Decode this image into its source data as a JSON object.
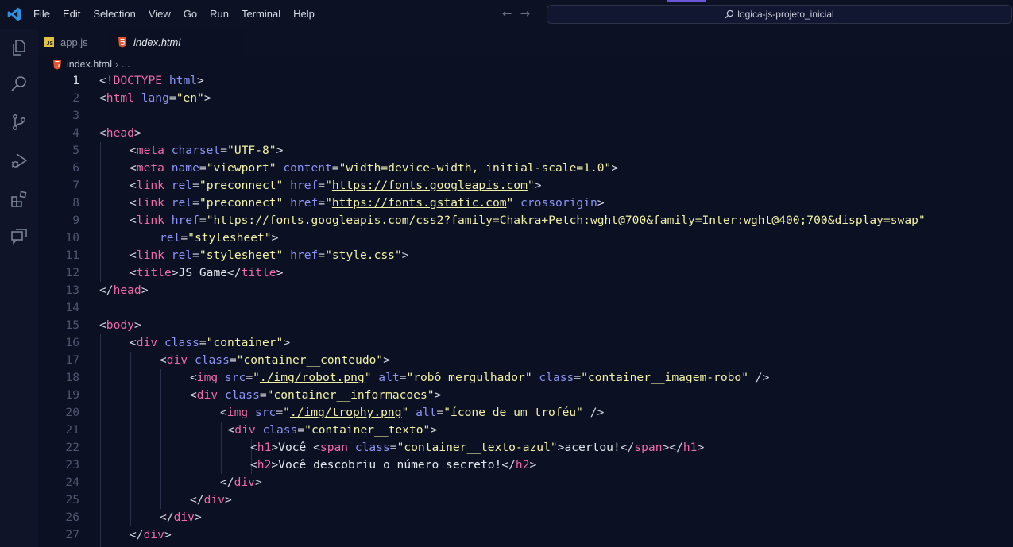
{
  "menu": [
    "File",
    "Edit",
    "Selection",
    "View",
    "Go",
    "Run",
    "Terminal",
    "Help"
  ],
  "search": {
    "text": "logica-js-projeto_inicial"
  },
  "tabs": [
    {
      "label": "app.js",
      "icon": "js-file-icon"
    },
    {
      "label": "index.html",
      "icon": "html-file-icon"
    }
  ],
  "breadcrumb": {
    "file": "index.html",
    "rest": "..."
  },
  "activity_icons": [
    "explorer-icon",
    "search-icon",
    "source-control-icon",
    "run-debug-icon",
    "extensions-icon",
    "chat-icon"
  ],
  "colors": {
    "tag": "#ef6aa9",
    "attr": "#8b94f2",
    "string": "#f1f1a6",
    "annotation": "#e0202a"
  },
  "current_line": 1,
  "code_lines": [
    {
      "n": "1",
      "indent": 0,
      "tokens": [
        [
          "p",
          "<"
        ],
        [
          "t",
          "!DOCTYPE"
        ],
        [
          "a",
          " html"
        ],
        [
          "p",
          ">"
        ]
      ]
    },
    {
      "n": "2",
      "indent": 0,
      "tokens": [
        [
          "p",
          "<"
        ],
        [
          "t",
          "html"
        ],
        [
          "a",
          " lang"
        ],
        [
          "p",
          "="
        ],
        [
          "s",
          "\"en\""
        ],
        [
          "p",
          ">"
        ]
      ]
    },
    {
      "n": "3",
      "indent": 0,
      "tokens": []
    },
    {
      "n": "4",
      "indent": 0,
      "tokens": [
        [
          "p",
          "<"
        ],
        [
          "t",
          "head"
        ],
        [
          "p",
          ">"
        ]
      ]
    },
    {
      "n": "5",
      "indent": 1,
      "tokens": [
        [
          "p",
          "<"
        ],
        [
          "t",
          "meta"
        ],
        [
          "a",
          " charset"
        ],
        [
          "p",
          "="
        ],
        [
          "s",
          "\"UTF-8\""
        ],
        [
          "p",
          ">"
        ]
      ]
    },
    {
      "n": "6",
      "indent": 1,
      "tokens": [
        [
          "p",
          "<"
        ],
        [
          "t",
          "meta"
        ],
        [
          "a",
          " name"
        ],
        [
          "p",
          "="
        ],
        [
          "s",
          "\"viewport\""
        ],
        [
          "a",
          " content"
        ],
        [
          "p",
          "="
        ],
        [
          "s",
          "\"width=device-width, initial-scale=1.0\""
        ],
        [
          "p",
          ">"
        ]
      ]
    },
    {
      "n": "7",
      "indent": 1,
      "tokens": [
        [
          "p",
          "<"
        ],
        [
          "t",
          "link"
        ],
        [
          "a",
          " rel"
        ],
        [
          "p",
          "="
        ],
        [
          "s",
          "\"preconnect\""
        ],
        [
          "a",
          " href"
        ],
        [
          "p",
          "="
        ],
        [
          "s",
          "\""
        ],
        [
          "u",
          "https://fonts.googleapis.com"
        ],
        [
          "s",
          "\""
        ],
        [
          "p",
          ">"
        ]
      ]
    },
    {
      "n": "8",
      "indent": 1,
      "tokens": [
        [
          "p",
          "<"
        ],
        [
          "t",
          "link"
        ],
        [
          "a",
          " rel"
        ],
        [
          "p",
          "="
        ],
        [
          "s",
          "\"preconnect\""
        ],
        [
          "a",
          " href"
        ],
        [
          "p",
          "="
        ],
        [
          "s",
          "\""
        ],
        [
          "u",
          "https://fonts.gstatic.com"
        ],
        [
          "s",
          "\""
        ],
        [
          "a",
          " crossorigin"
        ],
        [
          "p",
          ">"
        ]
      ]
    },
    {
      "n": "9",
      "indent": 1,
      "tokens": [
        [
          "p",
          "<"
        ],
        [
          "t",
          "link"
        ],
        [
          "a",
          " href"
        ],
        [
          "p",
          "="
        ],
        [
          "s",
          "\""
        ],
        [
          "u",
          "https://fonts.googleapis.com/css2?family=Chakra+Petch:wght@700&family=Inter:wght@400;700&display=swap"
        ],
        [
          "s",
          "\""
        ]
      ]
    },
    {
      "n": "10",
      "indent": 2,
      "tokens": [
        [
          "a",
          "rel"
        ],
        [
          "p",
          "="
        ],
        [
          "s",
          "\"stylesheet\""
        ],
        [
          "p",
          ">"
        ]
      ]
    },
    {
      "n": "11",
      "indent": 1,
      "tokens": [
        [
          "p",
          "<"
        ],
        [
          "t",
          "link"
        ],
        [
          "a",
          " rel"
        ],
        [
          "p",
          "="
        ],
        [
          "s",
          "\"stylesheet\""
        ],
        [
          "a",
          " href"
        ],
        [
          "p",
          "="
        ],
        [
          "s",
          "\""
        ],
        [
          "u",
          "style.css"
        ],
        [
          "s",
          "\""
        ],
        [
          "p",
          ">"
        ]
      ]
    },
    {
      "n": "12",
      "indent": 1,
      "tokens": [
        [
          "p",
          "<"
        ],
        [
          "t",
          "title"
        ],
        [
          "p",
          ">"
        ],
        [
          "x",
          "JS Game"
        ],
        [
          "p",
          "</"
        ],
        [
          "t",
          "title"
        ],
        [
          "p",
          ">"
        ]
      ]
    },
    {
      "n": "13",
      "indent": 0,
      "tokens": [
        [
          "p",
          "</"
        ],
        [
          "t",
          "head"
        ],
        [
          "p",
          ">"
        ]
      ]
    },
    {
      "n": "14",
      "indent": 0,
      "tokens": []
    },
    {
      "n": "15",
      "indent": 0,
      "tokens": [
        [
          "p",
          "<"
        ],
        [
          "t",
          "body"
        ],
        [
          "p",
          ">"
        ]
      ]
    },
    {
      "n": "16",
      "indent": 1,
      "tokens": [
        [
          "p",
          "<"
        ],
        [
          "t",
          "div"
        ],
        [
          "a",
          " class"
        ],
        [
          "p",
          "="
        ],
        [
          "s",
          "\"container\""
        ],
        [
          "p",
          ">"
        ]
      ]
    },
    {
      "n": "17",
      "indent": 2,
      "tokens": [
        [
          "p",
          "<"
        ],
        [
          "t",
          "div"
        ],
        [
          "a",
          " class"
        ],
        [
          "p",
          "="
        ],
        [
          "s",
          "\"container__conteudo\""
        ],
        [
          "p",
          ">"
        ]
      ]
    },
    {
      "n": "18",
      "indent": 3,
      "tokens": [
        [
          "p",
          "<"
        ],
        [
          "t",
          "img"
        ],
        [
          "a",
          " src"
        ],
        [
          "p",
          "="
        ],
        [
          "s",
          "\""
        ],
        [
          "u",
          "./img/robot.png"
        ],
        [
          "s",
          "\""
        ],
        [
          "a",
          " alt"
        ],
        [
          "p",
          "="
        ],
        [
          "s",
          "\"robô mergulhador\""
        ],
        [
          "a",
          " class"
        ],
        [
          "p",
          "="
        ],
        [
          "s",
          "\"container__imagem-robo\""
        ],
        [
          "p",
          " />"
        ]
      ]
    },
    {
      "n": "19",
      "indent": 3,
      "tokens": [
        [
          "p",
          "<"
        ],
        [
          "t",
          "div"
        ],
        [
          "a",
          " class"
        ],
        [
          "p",
          "="
        ],
        [
          "s",
          "\"container__informacoes\""
        ],
        [
          "p",
          ">"
        ]
      ]
    },
    {
      "n": "20",
      "indent": 4,
      "tokens": [
        [
          "p",
          "<"
        ],
        [
          "t",
          "img"
        ],
        [
          "a",
          " src"
        ],
        [
          "p",
          "="
        ],
        [
          "s",
          "\""
        ],
        [
          "u",
          "./img/trophy.png"
        ],
        [
          "s",
          "\""
        ],
        [
          "a",
          " alt"
        ],
        [
          "p",
          "="
        ],
        [
          "s",
          "\"ícone de um troféu\""
        ],
        [
          "p",
          " />"
        ]
      ]
    },
    {
      "n": "21",
      "indent": 4.25,
      "tokens": [
        [
          "p",
          "<"
        ],
        [
          "t",
          "div"
        ],
        [
          "a",
          " class"
        ],
        [
          "p",
          "="
        ],
        [
          "s",
          "\"container__texto\""
        ],
        [
          "p",
          ">"
        ]
      ]
    },
    {
      "n": "22",
      "indent": 5,
      "tokens": [
        [
          "p",
          "<"
        ],
        [
          "t",
          "h1"
        ],
        [
          "p",
          ">"
        ],
        [
          "x",
          "Você "
        ],
        [
          "p",
          "<"
        ],
        [
          "t",
          "span"
        ],
        [
          "a",
          " class"
        ],
        [
          "p",
          "="
        ],
        [
          "s",
          "\"container__texto-azul\""
        ],
        [
          "p",
          ">"
        ],
        [
          "x",
          "acertou!"
        ],
        [
          "p",
          "</"
        ],
        [
          "t",
          "span"
        ],
        [
          "p",
          "></"
        ],
        [
          "t",
          "h1"
        ],
        [
          "p",
          ">"
        ]
      ]
    },
    {
      "n": "23",
      "indent": 5,
      "tokens": [
        [
          "p",
          "<"
        ],
        [
          "t",
          "h2"
        ],
        [
          "p",
          ">"
        ],
        [
          "x",
          "Você descobriu o número secreto!"
        ],
        [
          "p",
          "</"
        ],
        [
          "t",
          "h2"
        ],
        [
          "p",
          ">"
        ]
      ]
    },
    {
      "n": "24",
      "indent": 4,
      "tokens": [
        [
          "p",
          "</"
        ],
        [
          "t",
          "div"
        ],
        [
          "p",
          ">"
        ]
      ]
    },
    {
      "n": "25",
      "indent": 3,
      "tokens": [
        [
          "p",
          "</"
        ],
        [
          "t",
          "div"
        ],
        [
          "p",
          ">"
        ]
      ]
    },
    {
      "n": "26",
      "indent": 2,
      "tokens": [
        [
          "p",
          "</"
        ],
        [
          "t",
          "div"
        ],
        [
          "p",
          ">"
        ]
      ]
    },
    {
      "n": "27",
      "indent": 1,
      "tokens": [
        [
          "p",
          "</"
        ],
        [
          "t",
          "div"
        ],
        [
          "p",
          ">"
        ]
      ]
    }
  ]
}
